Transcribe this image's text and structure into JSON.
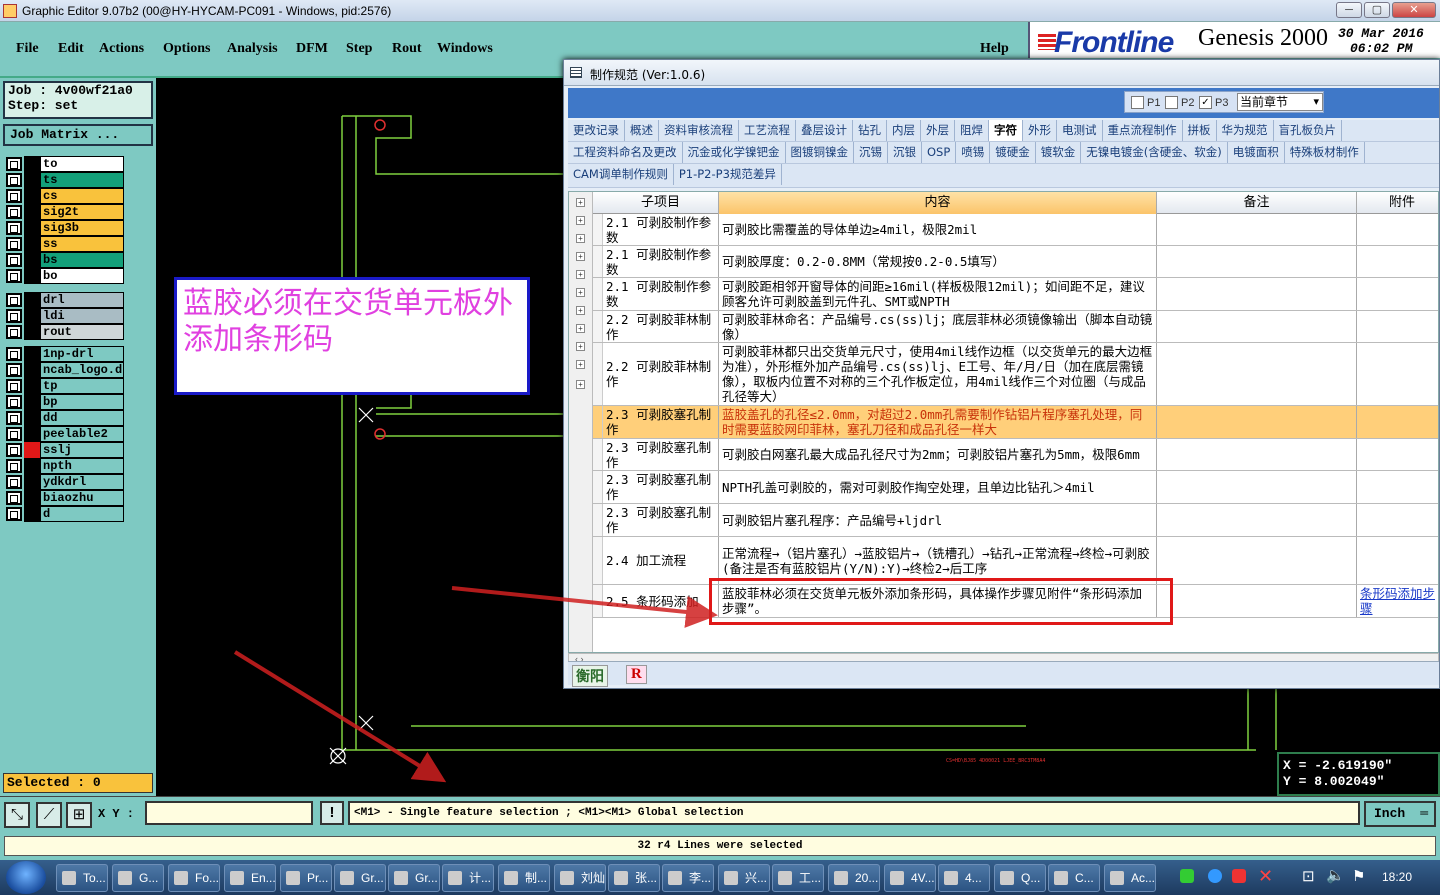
{
  "window": {
    "title": "Graphic Editor 9.07b2 (00@HY-HYCAM-PC091 - Windows, pid:2576)",
    "minimize": "─",
    "maximize": "▢",
    "close": "✕"
  },
  "menu": {
    "items": [
      "File",
      "Edit",
      "Actions",
      "Options",
      "Analysis",
      "DFM",
      "Step",
      "Rout",
      "Windows"
    ],
    "help": "Help"
  },
  "brand": {
    "logo": "Frontline",
    "product": "Genesis 2000",
    "date_line1": "30 Mar 2016",
    "date_line2": "06:02 PM"
  },
  "left_panel": {
    "job": "Job  : 4v00wf21a0",
    "step": "Step: set",
    "job_matrix": "Job Matrix ...",
    "selected": "Selected : 0",
    "layers": [
      {
        "name": "to",
        "color": "#ffffff",
        "chip": "#000000"
      },
      {
        "name": "ts",
        "color": "#13a07a",
        "chip": "#000000"
      },
      {
        "name": "cs",
        "color": "#f9c23c",
        "chip": "#000000"
      },
      {
        "name": "sig2t",
        "color": "#f9c23c",
        "chip": "#000000"
      },
      {
        "name": "sig3b",
        "color": "#f9c23c",
        "chip": "#000000"
      },
      {
        "name": "ss",
        "color": "#f9c23c",
        "chip": "#000000"
      },
      {
        "name": "bs",
        "color": "#13a07a",
        "chip": "#000000"
      },
      {
        "name": "bo",
        "color": "#ffffff",
        "chip": "#000000"
      },
      {
        "name": "drl",
        "color": "#a9bcc4",
        "chip": "#000000"
      },
      {
        "name": "ldi",
        "color": "#a9bcc4",
        "chip": "#000000"
      },
      {
        "name": "rout",
        "color": "#cfd6d8",
        "chip": "#000000"
      },
      {
        "name": "1np-drl",
        "color": "#7ec9c2",
        "chip": "#000000"
      },
      {
        "name": "ncab_logo.d",
        "color": "#7ec9c2",
        "chip": "#000000"
      },
      {
        "name": "tp",
        "color": "#7ec9c2",
        "chip": "#000000"
      },
      {
        "name": "bp",
        "color": "#7ec9c2",
        "chip": "#000000"
      },
      {
        "name": "dd",
        "color": "#7ec9c2",
        "chip": "#000000"
      },
      {
        "name": "peelable2",
        "color": "#7ec9c2",
        "chip": "#000000"
      },
      {
        "name": "sslj",
        "color": "#7ec9c2",
        "chip": "#e01818"
      },
      {
        "name": "npth",
        "color": "#7ec9c2",
        "chip": "#000000"
      },
      {
        "name": "ydkdrl",
        "color": "#7ec9c2",
        "chip": "#000000"
      },
      {
        "name": "biaozhu",
        "color": "#7ec9c2",
        "chip": "#000000"
      },
      {
        "name": "d",
        "color": "#7ec9c2",
        "chip": "#000000"
      }
    ]
  },
  "canvas": {
    "annotation": "蓝胶必须在交货单元板外添加条形码",
    "coord_x": "X = -2.619190\"",
    "coord_y": "Y =  8.002049\""
  },
  "command_bar": {
    "xy_label": "X Y :",
    "xy_value": "",
    "excl": "!",
    "hint": "<M1> - Single feature selection ; <M1><M1> Global selection",
    "unit": "Inch"
  },
  "status": {
    "message": "32 r4 Lines were selected"
  },
  "dialog": {
    "title": "制作规范 (Ver:1.0.6)",
    "filters": [
      {
        "label": "P1",
        "checked": false
      },
      {
        "label": "P2",
        "checked": false
      },
      {
        "label": "P3",
        "checked": true
      }
    ],
    "chapter_select": "当前章节",
    "tabs_row1": [
      "更改记录",
      "概述",
      "资料审核流程",
      "工艺流程",
      "叠层设计",
      "钻孔",
      "内层",
      "外层",
      "阻焊",
      "字符",
      "外形",
      "电测试",
      "重点流程制作",
      "拼板",
      "华为规范",
      "盲孔板负片"
    ],
    "active_tab": "字符",
    "tabs_row2": [
      "工程资料命名及更改",
      "沉金或化学镍钯金",
      "图镀铜镍金",
      "沉锡",
      "沉银",
      "OSP",
      "喷锡",
      "镀硬金",
      "镀软金",
      "无镍电镀金(含硬金、软金)",
      "电镀面积",
      "特殊板材制作"
    ],
    "tabs_row3": [
      "CAM调单制作规则",
      "P1-P2-P3规范差异"
    ],
    "columns": [
      "子项目",
      "内容",
      "备注",
      "附件"
    ],
    "rows": [
      {
        "sub": "2.1 可剥胶制作参数",
        "content": "可剥胶比需覆盖的导体单边≥4mil，极限2mil",
        "note": "",
        "attachment": ""
      },
      {
        "sub": "2.1 可剥胶制作参数",
        "content": "可剥胶厚度：0.2-0.8MM（常规按0.2-0.5填写）",
        "note": "",
        "attachment": ""
      },
      {
        "sub": "2.1 可剥胶制作参数",
        "content": "可剥胶距相邻开窗导体的间距≥16mil(样板极限12mil)；如间距不足，建议顾客允许可剥胶盖到元件孔、SMT或NPTH",
        "note": "",
        "attachment": ""
      },
      {
        "sub": "2.2 可剥胶菲林制作",
        "content": "可剥胶菲林命名：产品编号.cs(ss)lj；底层菲林必须镜像输出（脚本自动镜像）",
        "note": "",
        "attachment": ""
      },
      {
        "sub": "2.2 可剥胶菲林制作",
        "content": "可剥胶菲林都只出交货单元尺寸，使用4mil线作边框（以交货单元的最大边框为准），外形框外加产品编号.cs(ss)lj、E工号、年/月/日（加在底层需镜像），取板内位置不对称的三个孔作板定位，用4mil线作三个对位圈（与成品孔径等大）",
        "note": "",
        "attachment": ""
      },
      {
        "sub": "2.3 可剥胶塞孔制作",
        "content": "蓝胶盖孔的孔径≤2.0mm，对超过2.0mm孔需要制作钻铝片程序塞孔处理，同时需要蓝胶网印菲林，塞孔刀径和成品孔径一样大",
        "note": "",
        "attachment": "",
        "highlight": true
      },
      {
        "sub": "2.3 可剥胶塞孔制作",
        "content": "可剥胶白网塞孔最大成品孔径尺寸为2mm；可剥胶铝片塞孔为5mm，极限6mm",
        "note": "",
        "attachment": ""
      },
      {
        "sub": "2.3 可剥胶塞孔制作",
        "content": "NPTH孔盖可剥胶的，需对可剥胶作掏空处理，且单边比钻孔＞4mil",
        "note": "",
        "attachment": ""
      },
      {
        "sub": "2.3 可剥胶塞孔制作",
        "content": "可剥胶铝片塞孔程序：产品编号+ljdrl",
        "note": "",
        "attachment": ""
      },
      {
        "sub": "2.4 加工流程",
        "content": "正常流程→（铝片塞孔）→蓝胶铝片→（铣槽孔）→钻孔→正常流程→终检→可剥胶(备注是否有蓝胶铝片(Y/N):Y)→终检2→后工序",
        "note": "",
        "attachment": ""
      },
      {
        "sub": "2.5 条形码添加",
        "content": "蓝胶菲林必须在交货单元板外添加条形码，具体操作步骤见附件“条形码添加步骤”。",
        "note": "",
        "attachment": "条形码添加步骤"
      }
    ],
    "footer_tab": "衡阳",
    "footer_r": "R"
  },
  "taskbar": {
    "tasks": [
      "To...",
      "G...",
      "Fo...",
      "En...",
      "Pr...",
      "Gr...",
      "Gr...",
      "计...",
      "制...",
      "刘灿",
      "张...",
      "李...",
      "兴...",
      "工...",
      "20...",
      "4V...",
      "4...",
      "Q...",
      "C...",
      "Ac..."
    ],
    "clock": "18:20"
  },
  "colors": {
    "panel": "#7ec9c2",
    "highlight_row": "#ffcf7a",
    "annotation_text": "#e040e0",
    "annotation_border": "#1a1ac8",
    "arrow": "#d02020",
    "board_outline": "#7fcf3f"
  }
}
